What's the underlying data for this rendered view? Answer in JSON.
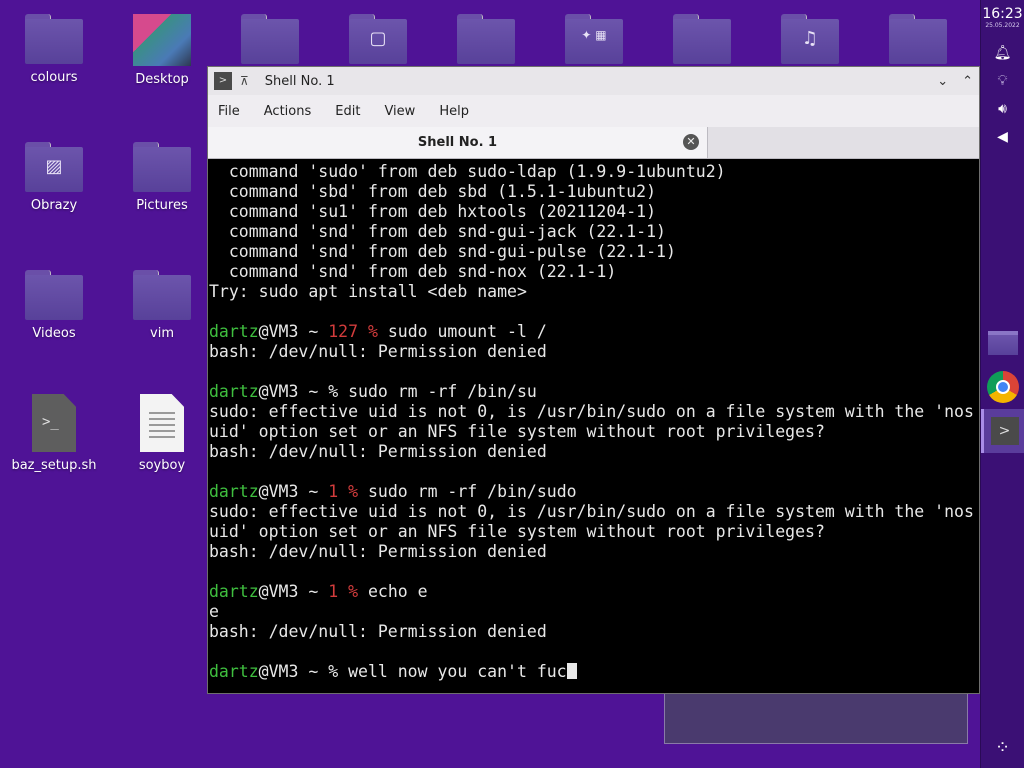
{
  "desktop": {
    "icons": [
      {
        "name": "colours"
      },
      {
        "name": "Desktop"
      },
      {
        "name": "Obrazy"
      },
      {
        "name": "Pictures"
      },
      {
        "name": "Videos"
      },
      {
        "name": "vim"
      },
      {
        "name": "baz_setup.sh"
      },
      {
        "name": "soyboy"
      }
    ]
  },
  "panel": {
    "time": "16:23",
    "date": "25.05.2022"
  },
  "window": {
    "title": "Shell No. 1",
    "menu": [
      "File",
      "Actions",
      "Edit",
      "View",
      "Help"
    ],
    "tab_label": "Shell No. 1"
  },
  "terminal": {
    "lines": [
      {
        "segments": [
          {
            "t": "  command 'sudo' from deb sudo-ldap (1.9.9-1ubuntu2)"
          }
        ]
      },
      {
        "segments": [
          {
            "t": "  command 'sbd' from deb sbd (1.5.1-1ubuntu2)"
          }
        ]
      },
      {
        "segments": [
          {
            "t": "  command 'su1' from deb hxtools (20211204-1)"
          }
        ]
      },
      {
        "segments": [
          {
            "t": "  command 'snd' from deb snd-gui-jack (22.1-1)"
          }
        ]
      },
      {
        "segments": [
          {
            "t": "  command 'snd' from deb snd-gui-pulse (22.1-1)"
          }
        ]
      },
      {
        "segments": [
          {
            "t": "  command 'snd' from deb snd-nox (22.1-1)"
          }
        ]
      },
      {
        "segments": [
          {
            "t": "Try: sudo apt install <deb name>"
          }
        ]
      },
      {
        "segments": [
          {
            "t": ""
          }
        ]
      },
      {
        "segments": [
          {
            "t": "dartz",
            "c": "user"
          },
          {
            "t": "@VM3 ~ "
          },
          {
            "t": "127 %",
            "c": "err"
          },
          {
            "t": " sudo umount -l /"
          }
        ]
      },
      {
        "segments": [
          {
            "t": "bash: /dev/null: Permission denied"
          }
        ]
      },
      {
        "segments": [
          {
            "t": ""
          }
        ]
      },
      {
        "segments": [
          {
            "t": "dartz",
            "c": "user"
          },
          {
            "t": "@VM3 ~ % sudo rm -rf /bin/su"
          }
        ]
      },
      {
        "segments": [
          {
            "t": "sudo: effective uid is not 0, is /usr/bin/sudo on a file system with the 'nos"
          }
        ]
      },
      {
        "segments": [
          {
            "t": "uid' option set or an NFS file system without root privileges?"
          }
        ]
      },
      {
        "segments": [
          {
            "t": "bash: /dev/null: Permission denied"
          }
        ]
      },
      {
        "segments": [
          {
            "t": ""
          }
        ]
      },
      {
        "segments": [
          {
            "t": "dartz",
            "c": "user"
          },
          {
            "t": "@VM3 ~ "
          },
          {
            "t": "1 %",
            "c": "err"
          },
          {
            "t": " sudo rm -rf /bin/sudo"
          }
        ]
      },
      {
        "segments": [
          {
            "t": "sudo: effective uid is not 0, is /usr/bin/sudo on a file system with the 'nos"
          }
        ]
      },
      {
        "segments": [
          {
            "t": "uid' option set or an NFS file system without root privileges?"
          }
        ]
      },
      {
        "segments": [
          {
            "t": "bash: /dev/null: Permission denied"
          }
        ]
      },
      {
        "segments": [
          {
            "t": ""
          }
        ]
      },
      {
        "segments": [
          {
            "t": "dartz",
            "c": "user"
          },
          {
            "t": "@VM3 ~ "
          },
          {
            "t": "1 %",
            "c": "err"
          },
          {
            "t": " echo e"
          }
        ]
      },
      {
        "segments": [
          {
            "t": "e"
          }
        ]
      },
      {
        "segments": [
          {
            "t": "bash: /dev/null: Permission denied"
          }
        ]
      },
      {
        "segments": [
          {
            "t": ""
          }
        ]
      },
      {
        "segments": [
          {
            "t": "dartz",
            "c": "user"
          },
          {
            "t": "@VM3 ~ % well now you can't fuc"
          }
        ],
        "cursor": true
      }
    ]
  },
  "colors": {
    "desktop_bg": "#4f1396",
    "prompt_user": "#3fbf3f",
    "prompt_error": "#d23c3c"
  }
}
